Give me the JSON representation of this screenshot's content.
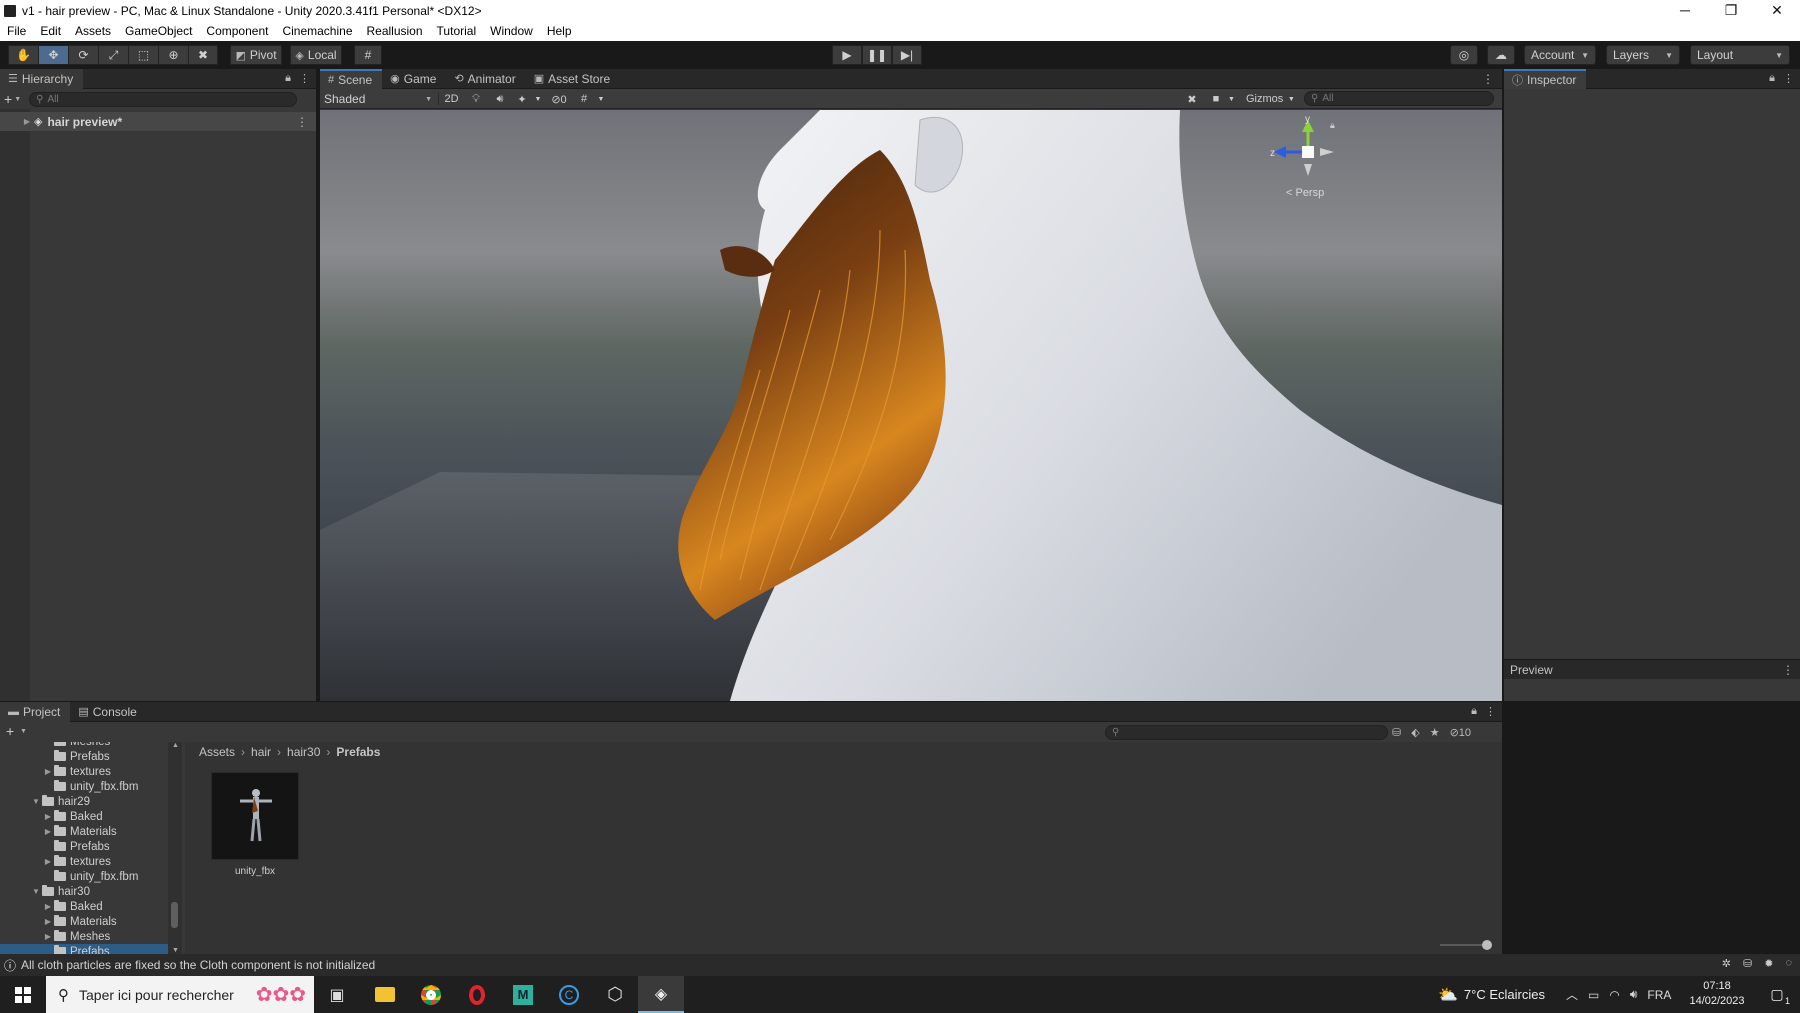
{
  "window": {
    "title": "v1 - hair preview - PC, Mac & Linux Standalone - Unity 2020.3.41f1 Personal* <DX12>",
    "controls": [
      "─",
      "❐",
      "✕"
    ]
  },
  "menu": [
    "File",
    "Edit",
    "Assets",
    "GameObject",
    "Component",
    "Cinemachine",
    "Reallusion",
    "Tutorial",
    "Window",
    "Help"
  ],
  "toolbar": {
    "pivot_label": "Pivot",
    "local_label": "Local",
    "account_label": "Account",
    "layers_label": "Layers",
    "layout_label": "Layout"
  },
  "hierarchy": {
    "tab_label": "Hierarchy",
    "search_placeholder": "All",
    "scene_item": "hair preview*"
  },
  "scene": {
    "tabs": [
      {
        "label": "Scene",
        "active": true
      },
      {
        "label": "Game",
        "active": false
      },
      {
        "label": "Animator",
        "active": false
      },
      {
        "label": "Asset Store",
        "active": false
      }
    ],
    "shading_mode": "Shaded",
    "mode_2d": "2D",
    "hidden_count": "0",
    "gizmos_label": "Gizmos",
    "search_placeholder": "All",
    "gizmo_axis_y": "y",
    "gizmo_axis_z": "z",
    "projection_label": "< Persp"
  },
  "inspector": {
    "tab_label": "Inspector",
    "preview_label": "Preview"
  },
  "project": {
    "tabs": [
      {
        "label": "Project",
        "active": true
      },
      {
        "label": "Console",
        "active": false
      }
    ],
    "hidden_count": "10",
    "breadcrumb": [
      "Assets",
      "hair",
      "hair30",
      "Prefabs"
    ],
    "tree": [
      {
        "label": "Meshes",
        "level": 2,
        "arrow": "",
        "partial": true
      },
      {
        "label": "Prefabs",
        "level": 2,
        "arrow": ""
      },
      {
        "label": "textures",
        "level": 2,
        "arrow": "▶"
      },
      {
        "label": "unity_fbx.fbm",
        "level": 2,
        "arrow": ""
      },
      {
        "label": "hair29",
        "level": 1,
        "arrow": "▼"
      },
      {
        "label": "Baked",
        "level": 2,
        "arrow": "▶"
      },
      {
        "label": "Materials",
        "level": 2,
        "arrow": "▶"
      },
      {
        "label": "Prefabs",
        "level": 2,
        "arrow": ""
      },
      {
        "label": "textures",
        "level": 2,
        "arrow": "▶"
      },
      {
        "label": "unity_fbx.fbm",
        "level": 2,
        "arrow": ""
      },
      {
        "label": "hair30",
        "level": 1,
        "arrow": "▼"
      },
      {
        "label": "Baked",
        "level": 2,
        "arrow": "▶"
      },
      {
        "label": "Materials",
        "level": 2,
        "arrow": "▶"
      },
      {
        "label": "Meshes",
        "level": 2,
        "arrow": "▶"
      },
      {
        "label": "Prefabs",
        "level": 2,
        "arrow": "",
        "selected": true
      }
    ],
    "asset_name": "unity_fbx"
  },
  "status": {
    "message": "All cloth particles are fixed so the Cloth component is not initialized"
  },
  "taskbar": {
    "search_placeholder": "Taper ici pour rechercher",
    "weather": "7°C  Eclaircies",
    "language": "FRA",
    "time": "07:18",
    "date": "14/02/2023",
    "notification_count": "1"
  },
  "colors": {
    "accent": "#3a79bb",
    "panel": "#383838",
    "hair_dark": "#3a1f0c",
    "hair_light": "#d8871f"
  }
}
